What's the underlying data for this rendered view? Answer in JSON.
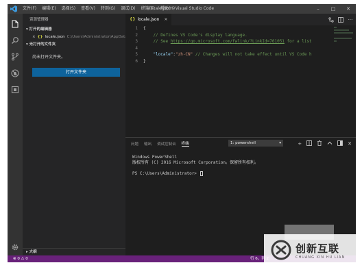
{
  "titlebar": {
    "menu": [
      "文件(F)",
      "编辑(E)",
      "选择(S)",
      "查看(V)",
      "转到(G)",
      "调试(D)",
      "终端(T)",
      "帮助(H)"
    ],
    "title": "locale.json - Visual Studio Code"
  },
  "activity": {
    "items": [
      "files-icon",
      "search-icon",
      "source-control-icon",
      "debug-icon",
      "extensions-icon",
      "settings-icon"
    ]
  },
  "sidebar": {
    "header": "资源管理器",
    "open_editors": "▾ 打开的编辑器",
    "open_file": {
      "close": "×",
      "icon": "{}",
      "name": "locale.json",
      "path": "C:\\Users\\Administrator\\AppData..."
    },
    "no_folder_section": "▾ 无打开的文件夹",
    "no_folder_msg": "尚未打开文件夹。",
    "open_folder_button": "打开文件夹",
    "outline": "▸ 大纲"
  },
  "editor": {
    "tab": {
      "icon": "{}",
      "name": "locale.json",
      "close": "×"
    },
    "lines": [
      {
        "n": "1"
      },
      {
        "n": "2"
      },
      {
        "n": "3"
      },
      {
        "n": "4"
      },
      {
        "n": "5"
      },
      {
        "n": "6"
      }
    ],
    "code": {
      "l1": "{",
      "l2": "    // Defines VS Code's display language.",
      "l3a": "    // See ",
      "l3b": "https://go.microsoft.com/fwlink/?LinkId=761051",
      "l3c": " for a list",
      "l5key": "\"locale\"",
      "l5colon": ":",
      "l5val": "\"zh-CN\"",
      "l5com": " // Changes will not take effect until VS Code h",
      "l6": "}"
    }
  },
  "panel": {
    "tabs": [
      "问题",
      "输出",
      "调试控制台",
      "终端"
    ],
    "active_tab": "终端",
    "terminal_select": "1: powershell",
    "terminal_lines": [
      "Windows PowerShell",
      "版权所有 (C) 2016 Microsoft Corporation。保留所有权利。",
      "",
      "PS C:\\Users\\Administrator> "
    ]
  },
  "statusbar": {
    "left": "⊗ 0 ⚠ 0",
    "right": "行 6，列 2"
  },
  "watermark": {
    "cn": "创新互联",
    "en": "CHUANG XIN HU LIAN"
  },
  "colors": {
    "accent": "#0e639c",
    "status": "#68217a"
  }
}
